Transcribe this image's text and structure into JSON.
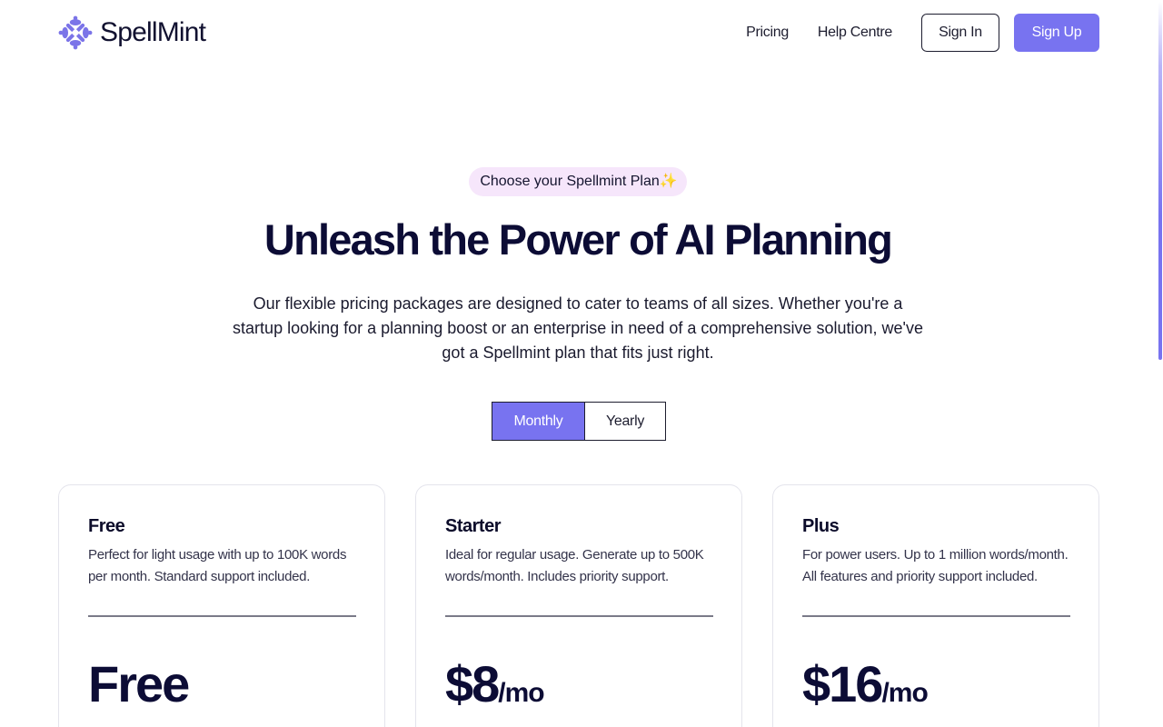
{
  "header": {
    "brand": "SpellMint",
    "logo_icon": "spellmint-logo-icon",
    "nav": {
      "pricing": "Pricing",
      "help": "Help Centre"
    },
    "sign_in": "Sign In",
    "sign_up": "Sign Up"
  },
  "hero": {
    "badge": "Choose your Spellmint Plan✨",
    "title": "Unleash the Power of AI Planning",
    "description": "Our flexible pricing packages are designed to cater to teams of all sizes. Whether you're a startup looking for a planning boost or an enterprise in need of a comprehensive solution, we've got a Spellmint plan that fits just right."
  },
  "billing": {
    "monthly": "Monthly",
    "yearly": "Yearly",
    "selected": "Monthly"
  },
  "plans": [
    {
      "name": "Free",
      "description": "Perfect for light usage with up to 100K words per month. Standard support included.",
      "price": "Free",
      "period": ""
    },
    {
      "name": "Starter",
      "description": "Ideal for regular usage. Generate up to 500K words/month. Includes priority support.",
      "price": "$8",
      "period": "/mo"
    },
    {
      "name": "Plus",
      "description": "For power users. Up to 1 million words/month. All features and priority support included.",
      "price": "$16",
      "period": "/mo"
    }
  ],
  "colors": {
    "accent": "#7873f0",
    "badge_bg": "#f6e6fb",
    "heading": "#0c0c35"
  }
}
